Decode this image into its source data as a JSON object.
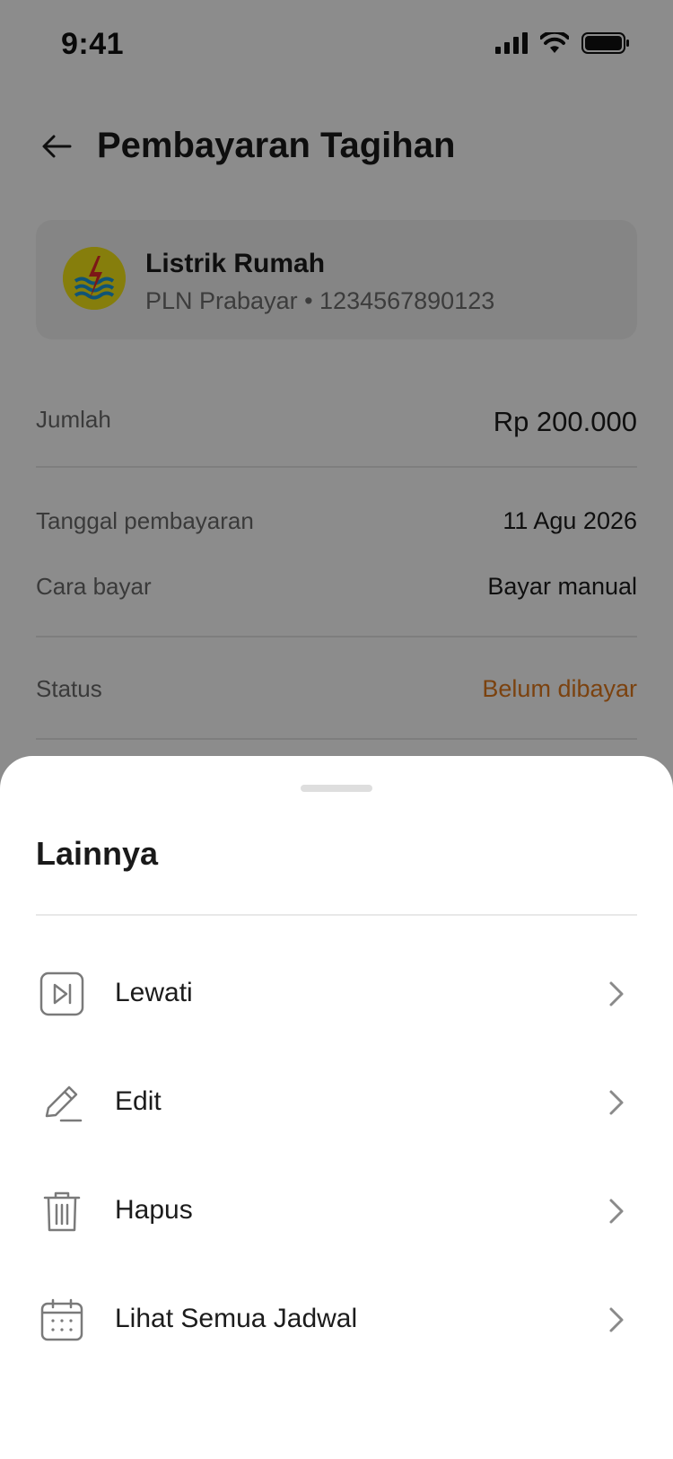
{
  "status_bar": {
    "time": "9:41"
  },
  "header": {
    "title": "Pembayaran Tagihan"
  },
  "bill": {
    "name": "Listrik Rumah",
    "subtitle": "PLN Prabayar • 1234567890123"
  },
  "details": {
    "amount_label": "Jumlah",
    "amount_value": "Rp 200.000",
    "date_label": "Tanggal pembayaran",
    "date_value": "11 Agu 2026",
    "method_label": "Cara bayar",
    "method_value": "Bayar manual",
    "status_label": "Status",
    "status_value": "Belum dibayar"
  },
  "sheet": {
    "title": "Lainnya",
    "items": [
      {
        "label": "Lewati",
        "icon": "skip-icon"
      },
      {
        "label": "Edit",
        "icon": "pencil-icon"
      },
      {
        "label": "Hapus",
        "icon": "trash-icon"
      },
      {
        "label": "Lihat Semua Jadwal",
        "icon": "calendar-icon"
      }
    ]
  },
  "colors": {
    "status_unpaid": "#e0781c",
    "overlay": "rgba(0,0,0,0.45)"
  }
}
